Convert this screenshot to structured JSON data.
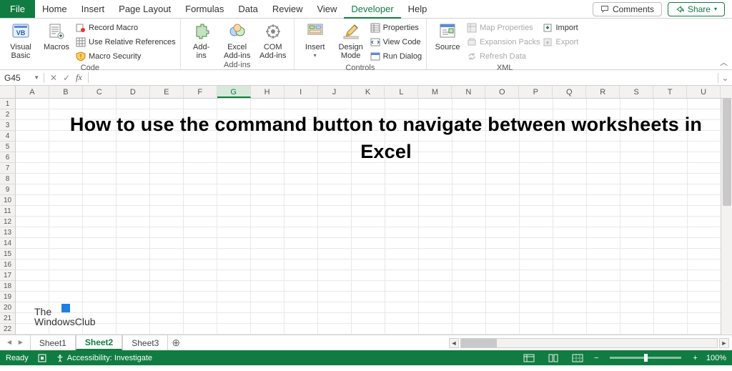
{
  "tabs": {
    "file": "File",
    "items": [
      "Home",
      "Insert",
      "Page Layout",
      "Formulas",
      "Data",
      "Review",
      "View",
      "Developer",
      "Help"
    ],
    "activeIndex": 7
  },
  "topRight": {
    "comments": "Comments",
    "share": "Share"
  },
  "ribbon": {
    "code": {
      "visualBasic": "Visual\nBasic",
      "macros": "Macros",
      "recordMacro": "Record Macro",
      "useRelative": "Use Relative References",
      "macroSecurity": "Macro Security",
      "label": "Code"
    },
    "addins": {
      "addins": "Add-\nins",
      "excelAddins": "Excel\nAdd-ins",
      "comAddins": "COM\nAdd-ins",
      "label": "Add-ins"
    },
    "controls": {
      "insert": "Insert",
      "designMode": "Design\nMode",
      "properties": "Properties",
      "viewCode": "View Code",
      "runDialog": "Run Dialog",
      "label": "Controls"
    },
    "xml": {
      "source": "Source",
      "mapProps": "Map Properties",
      "expansion": "Expansion Packs",
      "refresh": "Refresh Data",
      "import": "Import",
      "export": "Export",
      "label": "XML"
    }
  },
  "formulaBar": {
    "nameBox": "G45",
    "formula": ""
  },
  "columns": [
    "A",
    "B",
    "C",
    "D",
    "E",
    "F",
    "G",
    "H",
    "I",
    "J",
    "K",
    "L",
    "M",
    "N",
    "O",
    "P",
    "Q",
    "R",
    "S",
    "T",
    "U"
  ],
  "selectedCol": "G",
  "rows": [
    "1",
    "2",
    "3",
    "4",
    "5",
    "6",
    "7",
    "8",
    "9",
    "10",
    "11",
    "12",
    "13",
    "14",
    "15",
    "16",
    "17",
    "18",
    "19",
    "20",
    "21",
    "22"
  ],
  "headline": "How to use the command button to navigate between worksheets in Excel",
  "watermark": {
    "line1": "The",
    "line2": "WindowsClub"
  },
  "sheets": {
    "items": [
      "Sheet1",
      "Sheet2",
      "Sheet3"
    ],
    "activeIndex": 1
  },
  "status": {
    "ready": "Ready",
    "accessibility": "Accessibility: Investigate",
    "zoom": "100%"
  }
}
